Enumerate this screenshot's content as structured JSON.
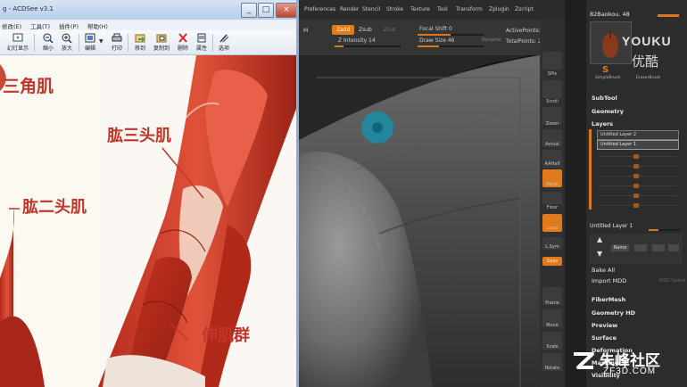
{
  "acdsee": {
    "title": "g - ACDSee v3.1",
    "controls": [
      "_",
      "□",
      "×"
    ],
    "menu": [
      "修改(E)",
      "工具(T)",
      "插件(P)",
      "帮助(H)"
    ],
    "toolbar": [
      {
        "label": "幻灯显示",
        "icon": "slideshow-icon"
      },
      {
        "label": "缩小",
        "icon": "zoom-out-icon"
      },
      {
        "label": "放大",
        "icon": "zoom-in-icon"
      },
      {
        "label": "编辑",
        "icon": "edit-icon"
      },
      {
        "label": "打印",
        "icon": "print-icon"
      },
      {
        "label": "移到",
        "icon": "move-icon"
      },
      {
        "label": "复制到",
        "icon": "copy-icon"
      },
      {
        "label": "删除",
        "icon": "delete-icon"
      },
      {
        "label": "属性",
        "icon": "properties-icon"
      },
      {
        "label": "选项",
        "icon": "options-icon"
      }
    ],
    "image_labels": {
      "triceps_left": "三角肌",
      "biceps": "肱二头肌",
      "triceps": "肱三头肌",
      "extensors": "伸肌群"
    }
  },
  "zbrush": {
    "menu": [
      "Preferences",
      "Render",
      "Stencil",
      "Stroke",
      "Texture",
      "Tool",
      "Transform",
      "Zplugin",
      "Zscript"
    ],
    "toolbar": {
      "m_label": "M",
      "zadd": "Zadd",
      "zsub": "Zsub",
      "zcut": "Zcut",
      "z_intensity": "Z Intensity 14",
      "focal_shift": "Focal Shift 0",
      "draw_size": "Draw Size 46",
      "dynamic": "Dynamic",
      "active_points": "ActivePoints: 133,",
      "total_points": "TotalPoints: 2.424"
    },
    "shelf": [
      "BPR",
      "SPix",
      "Scroll",
      "Zoom",
      "Actual",
      "AAHalf",
      "Persp",
      "Floor",
      "Local",
      "L.Sym",
      "Gxyz",
      "Frame",
      "Move",
      "Scale",
      "Rotate"
    ],
    "panel": {
      "tool_header": "82Baokou. 48",
      "thumb1": "SimpleBrush",
      "thumb2": "EraserBrush",
      "subtool": "SubTool",
      "geometry": "Geometry",
      "layers": "Layers",
      "layer_top1": "Untitled Layer 2",
      "layer_top2": "Untitled Layer 1",
      "layer_current": "Untitled Layer 1",
      "layer_btn_name": "Name",
      "bake_all": "Bake All",
      "import_mdd": "Import MDD",
      "mdd_speed": "MDD Speed",
      "fibermesh": "FiberMesh",
      "geometry_hd": "Geometry HD",
      "preview": "Preview",
      "surface": "Surface",
      "deformation": "Deformation",
      "masking": "Masking",
      "visibility": "Visibility"
    }
  },
  "watermarks": {
    "youku": "YOUKU",
    "youku_cn": "优酷",
    "zf_cn": "朱峰社区",
    "zf_url": "ZF3D.COM"
  },
  "colors": {
    "zbrush_accent": "#e07a1a",
    "muscle_label": "#c2352a",
    "brush_cursor": "#1a8ea8"
  }
}
